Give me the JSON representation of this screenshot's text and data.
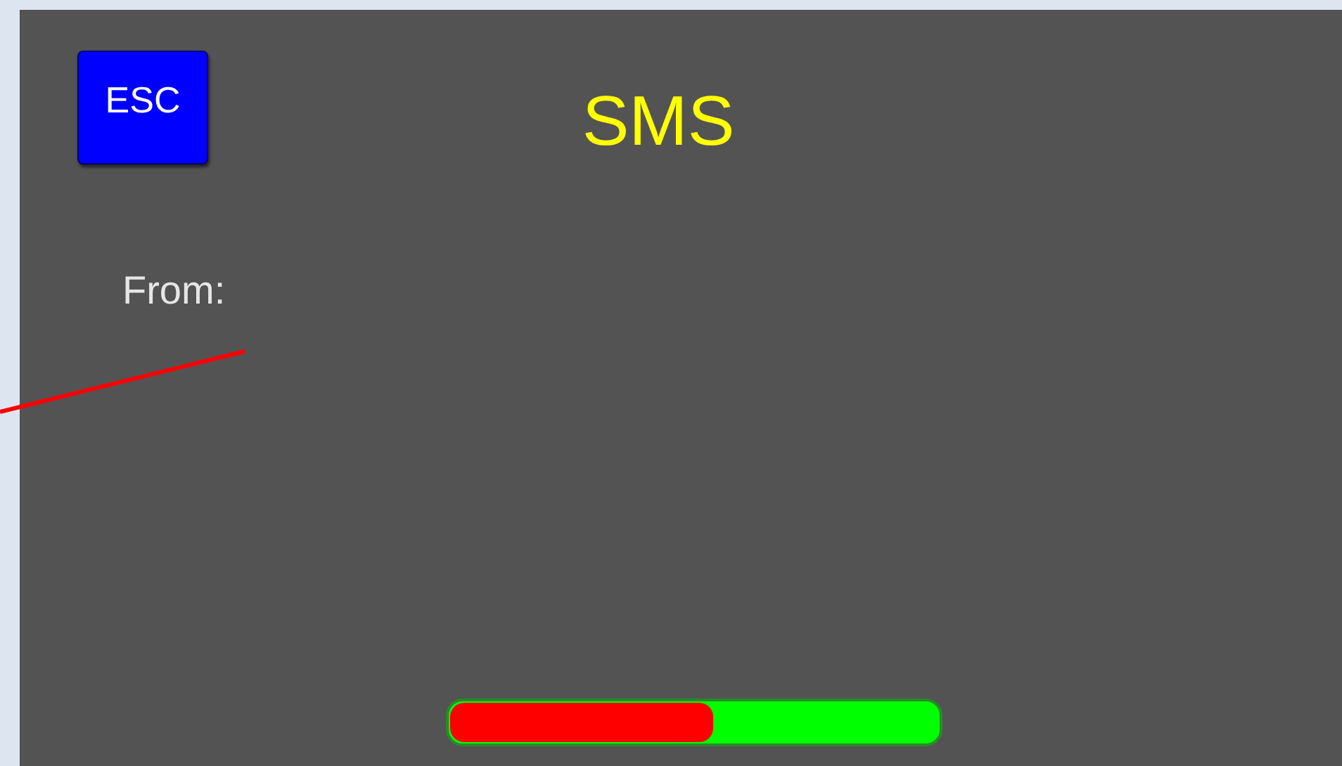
{
  "esc_button": "ESC",
  "title": "SMS",
  "from_label": "From:",
  "progress": {
    "level": 0.54
  }
}
